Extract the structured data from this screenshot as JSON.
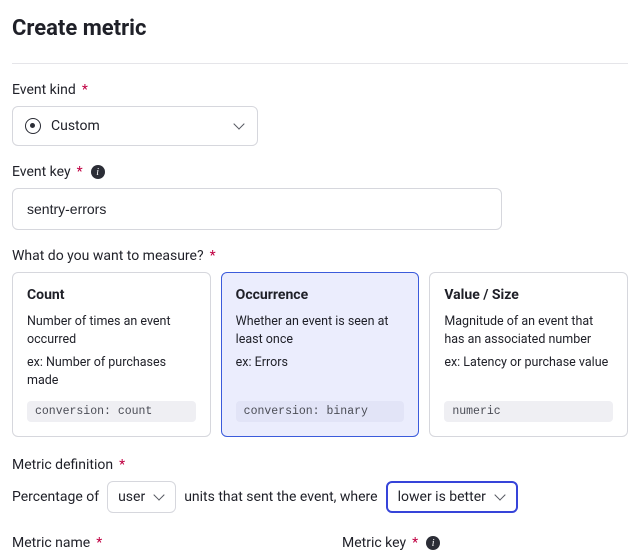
{
  "page": {
    "title": "Create metric"
  },
  "eventKind": {
    "label": "Event kind",
    "value": "Custom"
  },
  "eventKey": {
    "label": "Event key",
    "value": "sentry-errors"
  },
  "measure": {
    "label": "What do you want to measure?",
    "options": [
      {
        "title": "Count",
        "desc": "Number of times an event occurred",
        "example": "ex: Number of purchases made",
        "tag": "conversion: count",
        "selected": false
      },
      {
        "title": "Occurrence",
        "desc": "Whether an event is seen at least once",
        "example": "ex: Errors",
        "tag": "conversion: binary",
        "selected": true
      },
      {
        "title": "Value / Size",
        "desc": "Magnitude of an event that has an associated number",
        "example": "ex: Latency or purchase value",
        "tag": "numeric",
        "selected": false
      }
    ]
  },
  "definition": {
    "label": "Metric definition",
    "prefix": "Percentage of",
    "unit": "user",
    "middle": "units that sent the event, where",
    "direction": "lower is better"
  },
  "metricName": {
    "label": "Metric name"
  },
  "metricKey": {
    "label": "Metric key"
  }
}
